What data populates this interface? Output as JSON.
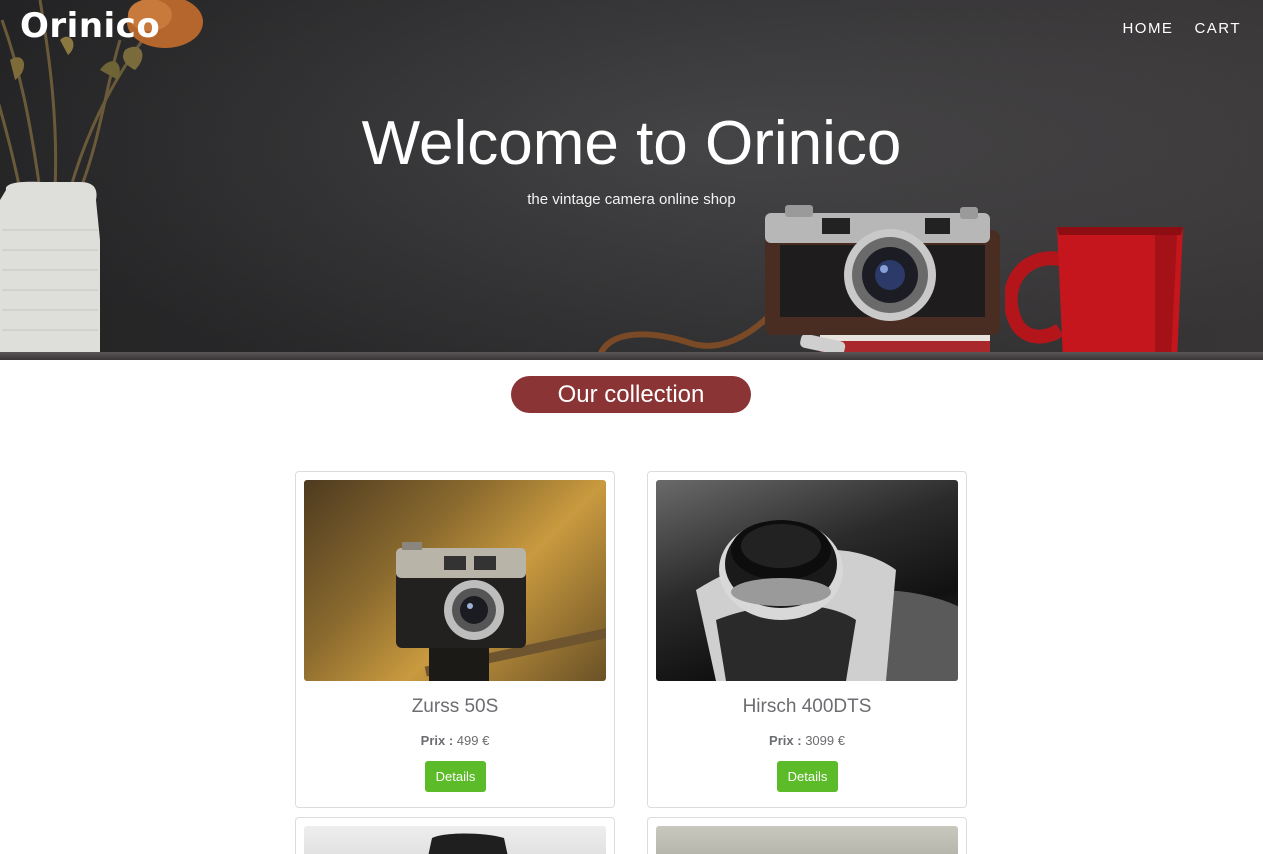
{
  "brand": {
    "logo": "Orinico"
  },
  "nav": {
    "items": [
      {
        "label": "HOME"
      },
      {
        "label": "CART"
      }
    ]
  },
  "hero": {
    "title": "Welcome to Orinico",
    "subtitle": "the vintage camera online shop"
  },
  "collection": {
    "heading": "Our collection",
    "accent_color": "#8a3436",
    "button_color": "#5cbb28",
    "products": [
      {
        "name": "Zurss 50S",
        "price_label": "Prix :",
        "price": "499 €",
        "button": "Details"
      },
      {
        "name": "Hirsch 400DTS",
        "price_label": "Prix :",
        "price": "3099 €",
        "button": "Details"
      }
    ]
  }
}
